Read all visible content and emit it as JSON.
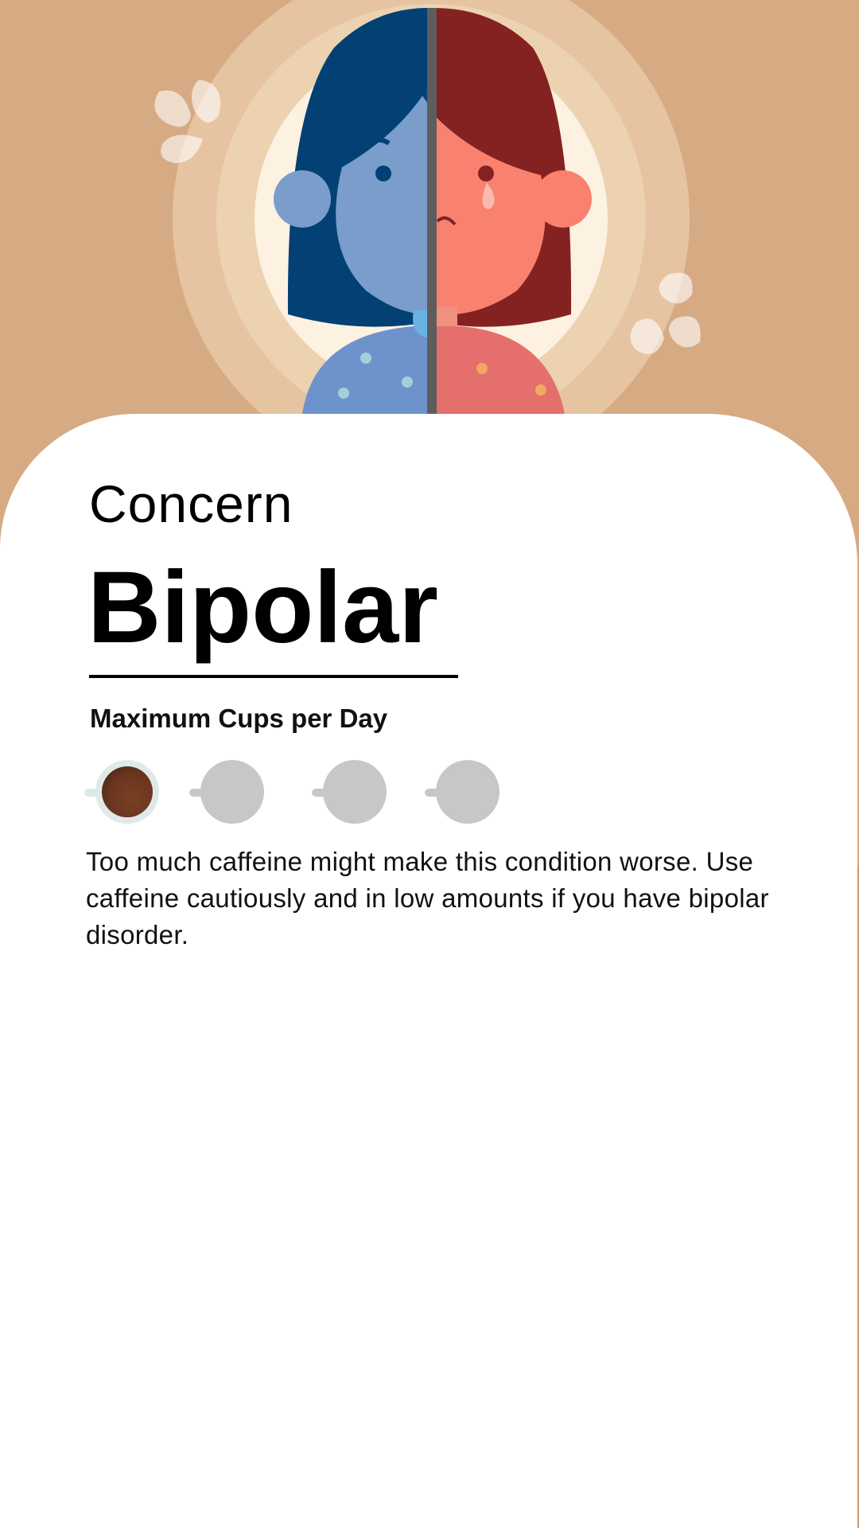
{
  "hero": {
    "illustration_icon": "split-face-bipolar-illustration",
    "colors": {
      "background": "#d6ab84",
      "ring_outer": "#e6c4a1",
      "ring_middle": "#ecd2b0",
      "ring_inner": "#fdf1e2",
      "blue_hair": "#034174",
      "blue_skin": "#7b9dcc",
      "red_hair": "#842221",
      "red_skin": "#f8826f",
      "divider": "#5d5d5d"
    }
  },
  "card": {
    "eyebrow": "Concern",
    "title": "Bipolar",
    "subheading": "Maximum Cups per Day",
    "cups": {
      "max": 1,
      "total": 4,
      "icons": [
        "coffee-cup-icon",
        "empty-cup-icon",
        "empty-cup-icon",
        "empty-cup-icon"
      ],
      "filled_color": "#6a3520",
      "empty_color": "#c7c7c7"
    },
    "description": "Too much caffeine might make this condition worse. Use caffeine cautiously and in low amounts if you have bipolar disorder."
  }
}
